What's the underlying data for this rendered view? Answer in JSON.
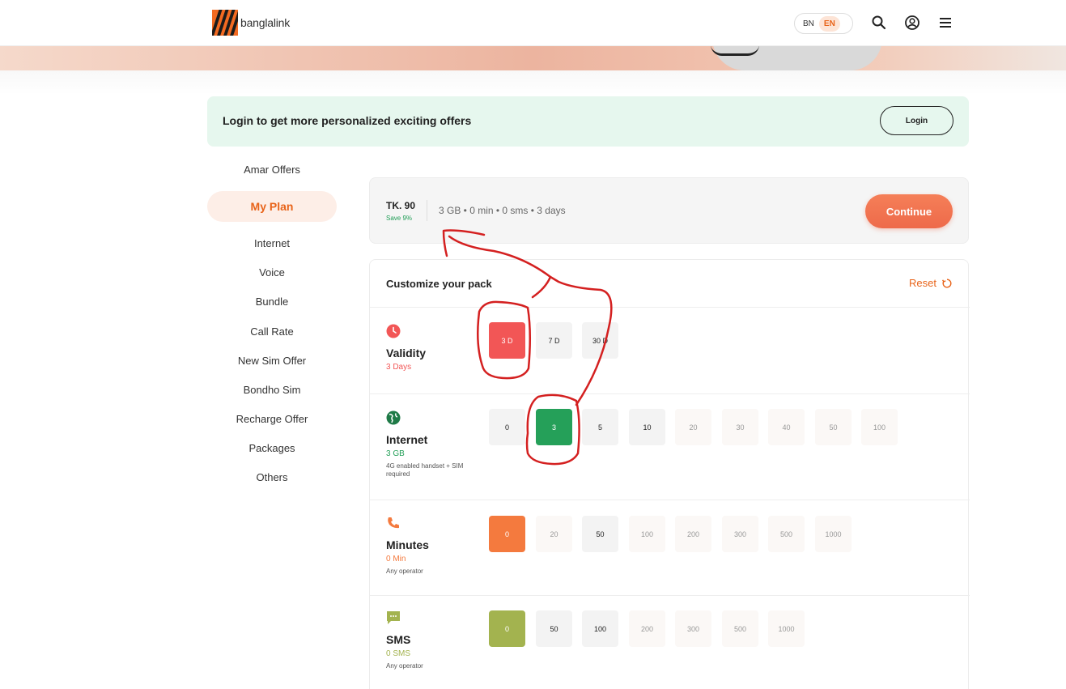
{
  "header": {
    "logo_text": "banglalink",
    "lang_bn": "BN",
    "lang_en": "EN",
    "icons": [
      "search-icon",
      "user-icon",
      "menu-icon"
    ]
  },
  "login_banner": {
    "message": "Login to get more personalized exciting offers",
    "login_label": "Login"
  },
  "sidebar": {
    "items": [
      {
        "label": "Amar Offers"
      },
      {
        "label": "My Plan",
        "active": true
      },
      {
        "label": "Internet"
      },
      {
        "label": "Voice"
      },
      {
        "label": "Bundle"
      },
      {
        "label": "Call Rate"
      },
      {
        "label": "New Sim Offer"
      },
      {
        "label": "Bondho Sim"
      },
      {
        "label": "Recharge Offer"
      },
      {
        "label": "Packages"
      },
      {
        "label": "Others"
      }
    ]
  },
  "summary": {
    "price": "TK. 90",
    "save": "Save 9%",
    "details": "3 GB • 0 min • 0 sms • 3 days",
    "continue_label": "Continue"
  },
  "customize": {
    "title": "Customize your pack",
    "reset_label": "Reset",
    "validity": {
      "name": "Validity",
      "value": "3 Days",
      "color": "#f25656",
      "options": [
        "3 D",
        "7 D",
        "30 D"
      ],
      "selected": 0
    },
    "internet": {
      "name": "Internet",
      "value": "3 GB",
      "note": "4G enabled handset + SIM required",
      "color": "#25a059",
      "options": [
        "0",
        "3",
        "5",
        "10",
        "20",
        "30",
        "40",
        "50",
        "100"
      ],
      "selected": 1
    },
    "minutes": {
      "name": "Minutes",
      "value": "0 Min",
      "note": "Any operator",
      "color": "#f47a3e",
      "options": [
        "0",
        "20",
        "50",
        "100",
        "200",
        "300",
        "500",
        "1000"
      ],
      "selected": 0
    },
    "sms": {
      "name": "SMS",
      "value": "0 SMS",
      "note": "Any operator",
      "color": "#a3b34f",
      "options": [
        "0",
        "50",
        "100",
        "200",
        "300",
        "500",
        "1000"
      ],
      "selected": 0
    }
  }
}
